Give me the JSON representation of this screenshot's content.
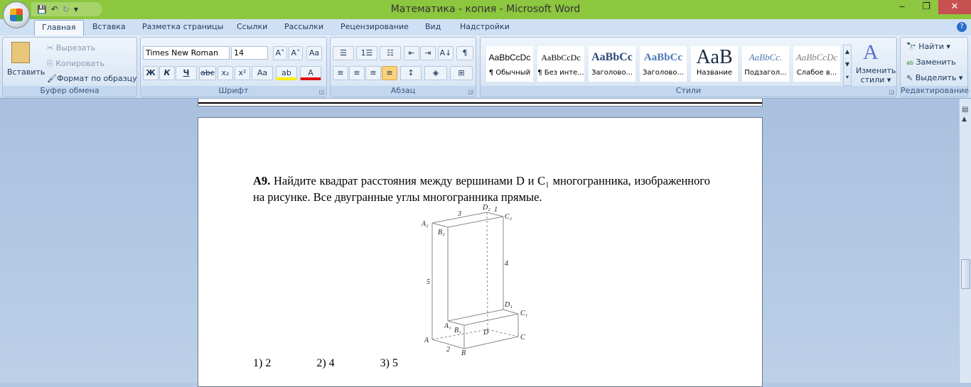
{
  "window": {
    "title": "Математика - копия - Microsoft Word",
    "minimize": "‒",
    "restore": "❐",
    "close": "✕"
  },
  "qat": {
    "save": "💾",
    "undo": "↶",
    "redo": "↻",
    "customize": "▾"
  },
  "tabs": [
    "Главная",
    "Вставка",
    "Разметка страницы",
    "Ссылки",
    "Рассылки",
    "Рецензирование",
    "Вид",
    "Надстройки"
  ],
  "clipboard": {
    "paste": "Вставить",
    "cut": "Вырезать",
    "copy": "Копировать",
    "format_painter": "Формат по образцу",
    "label": "Буфер обмена"
  },
  "font": {
    "name": "Times New Roman",
    "size": "14",
    "grow": "A˄",
    "shrink": "A˅",
    "clear": "Aa",
    "bold": "Ж",
    "italic": "К",
    "underline": "Ч",
    "strike": "abc",
    "sub": "x₂",
    "sup": "x²",
    "case": "Aa",
    "highlight": "ab",
    "color": "A",
    "label": "Шрифт"
  },
  "paragraph": {
    "label": "Абзац",
    "bullets": "☰",
    "numbering": "1☰",
    "multilevel": "☷",
    "dec_indent": "⇤",
    "inc_indent": "⇥",
    "sort": "A↓",
    "show_marks": "¶",
    "align_left": "≡",
    "center": "≡",
    "align_right": "≡",
    "justify": "≡",
    "spacing": "↕",
    "shading": "◈",
    "borders": "⊞"
  },
  "styles": {
    "label": "Стили",
    "items": [
      {
        "preview": "AaBbCcDc",
        "name": "¶ Обычный"
      },
      {
        "preview": "AaBbCcDc",
        "name": "¶ Без инте..."
      },
      {
        "preview": "AaBbCc",
        "name": "Заголово..."
      },
      {
        "preview": "AaBbCc",
        "name": "Заголово..."
      },
      {
        "preview": "AaB",
        "name": "Название"
      },
      {
        "preview": "AaBbCc.",
        "name": "Подзагол..."
      },
      {
        "preview": "AaBbCcDc",
        "name": "Слабое в..."
      }
    ],
    "change": "Изменить стили ▾"
  },
  "editing": {
    "find": "Найти ▾",
    "replace": "Заменить",
    "select": "Выделить ▾",
    "label": "Редактирование"
  },
  "document": {
    "problem_num": "А9.",
    "problem_text": " Найдите квадрат расстояния между вершинами D и C₁ многогранника, изображенного на рисунке. Все двугранные углы многогранника прямые.",
    "figure_labels": {
      "A": "A",
      "B": "B",
      "C": "C",
      "D": "D",
      "A1": "A₁",
      "B1": "B₁",
      "C1": "C₁",
      "D1": "D₁",
      "A2": "A₂",
      "B2": "B₂",
      "C2": "C₂",
      "D2": "D₂",
      "e3": "3",
      "e1": "1",
      "e4": "4",
      "e5": "5",
      "e2": "2"
    },
    "answers": [
      "1) 2",
      "2) 4",
      "3) 5"
    ]
  }
}
